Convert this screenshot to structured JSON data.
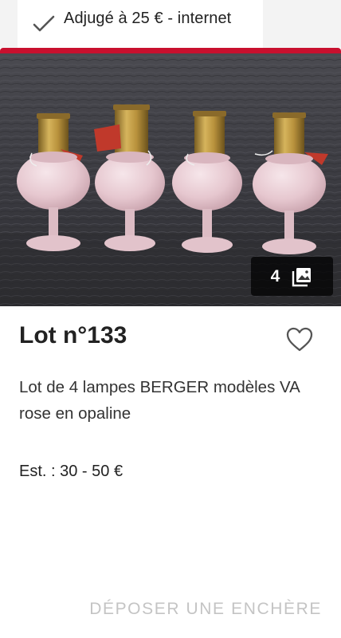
{
  "sold_banner": {
    "label": "Adjugé à 25 € - internet",
    "icon": "checkmark-icon"
  },
  "accent_color": "#c8102e",
  "photo": {
    "alt": "4 lampes Berger roses en opaline",
    "image_count": "4",
    "gallery_icon": "photo-gallery-icon"
  },
  "lot": {
    "title": "Lot n°133",
    "description": "Lot de 4 lampes BERGER modèles VA rose en opaline",
    "estimate": "Est. : 30 - 50 €",
    "favorite_icon": "heart-outline-icon"
  },
  "actions": {
    "bid_label": "DÉPOSER UNE ENCHÈRE"
  }
}
